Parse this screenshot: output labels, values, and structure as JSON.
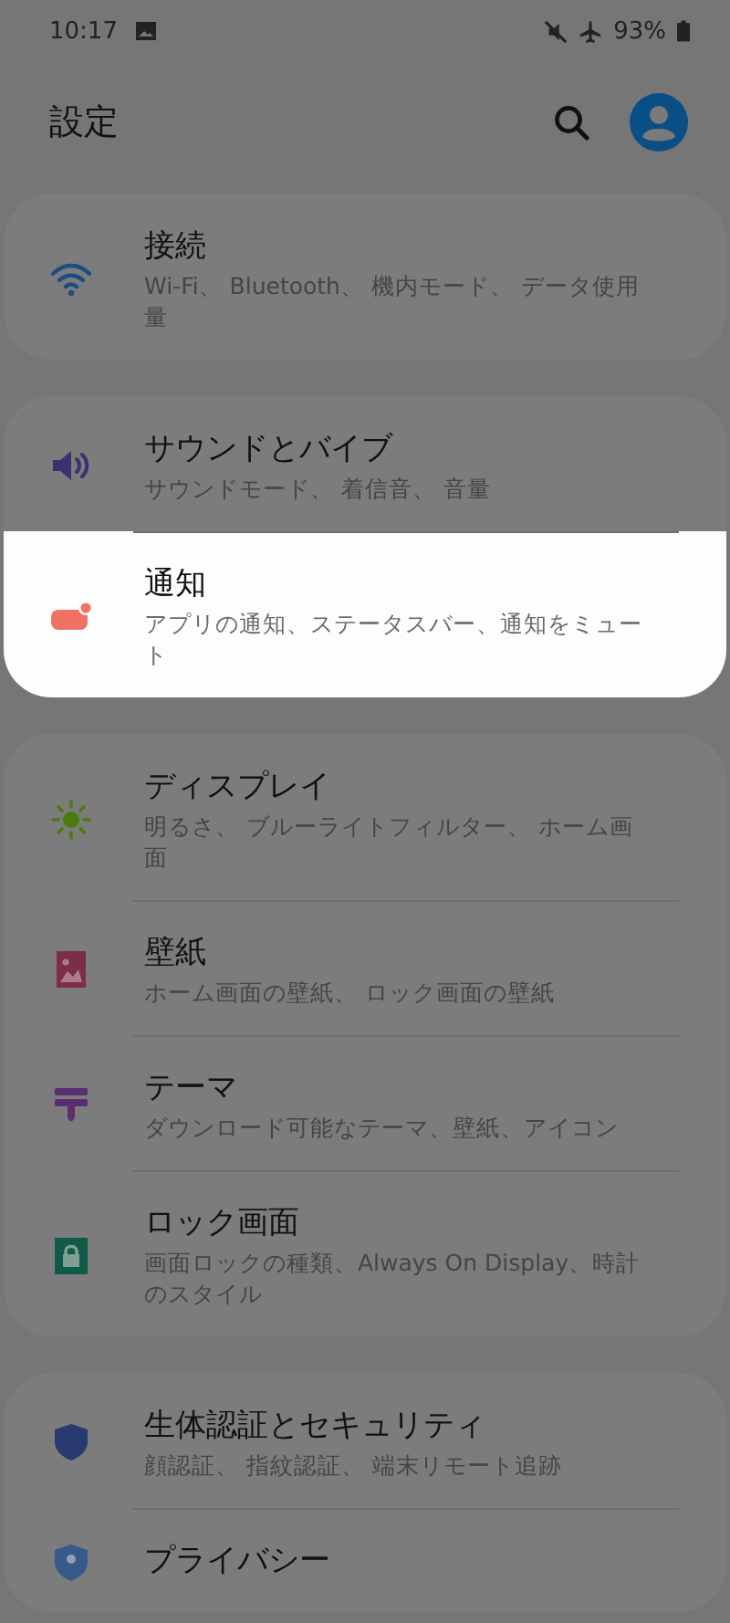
{
  "status_bar": {
    "time": "10:17",
    "battery": "93%"
  },
  "header": {
    "title": "設定"
  },
  "groups": [
    {
      "items": [
        {
          "kind": "wifi",
          "title": "接続",
          "subtitle": "Wi-Fi、 Bluetooth、 機内モード、 データ使用量",
          "highlighted": false
        }
      ]
    },
    {
      "items": [
        {
          "kind": "sound",
          "title": "サウンドとバイブ",
          "subtitle": "サウンドモード、 着信音、 音量",
          "highlighted": false
        },
        {
          "kind": "notification",
          "title": "通知",
          "subtitle": "アプリの通知、ステータスバー、通知をミュート",
          "highlighted": true
        }
      ]
    },
    {
      "items": [
        {
          "kind": "display",
          "title": "ディスプレイ",
          "subtitle": "明るさ、 ブルーライトフィルター、 ホーム画面",
          "highlighted": false
        },
        {
          "kind": "wallpaper",
          "title": "壁紙",
          "subtitle": "ホーム画面の壁紙、 ロック画面の壁紙",
          "highlighted": false
        },
        {
          "kind": "theme",
          "title": "テーマ",
          "subtitle": "ダウンロード可能なテーマ、壁紙、アイコン",
          "highlighted": false
        },
        {
          "kind": "lock",
          "title": "ロック画面",
          "subtitle": "画面ロックの種類、Always On Display、時計のスタイル",
          "highlighted": false
        }
      ]
    },
    {
      "items": [
        {
          "kind": "security",
          "title": "生体認証とセキュリティ",
          "subtitle": "顔認証、 指紋認証、 端末リモート追跡",
          "highlighted": false
        },
        {
          "kind": "privacy",
          "title": "プライバシー",
          "highlighted": false
        }
      ]
    }
  ]
}
